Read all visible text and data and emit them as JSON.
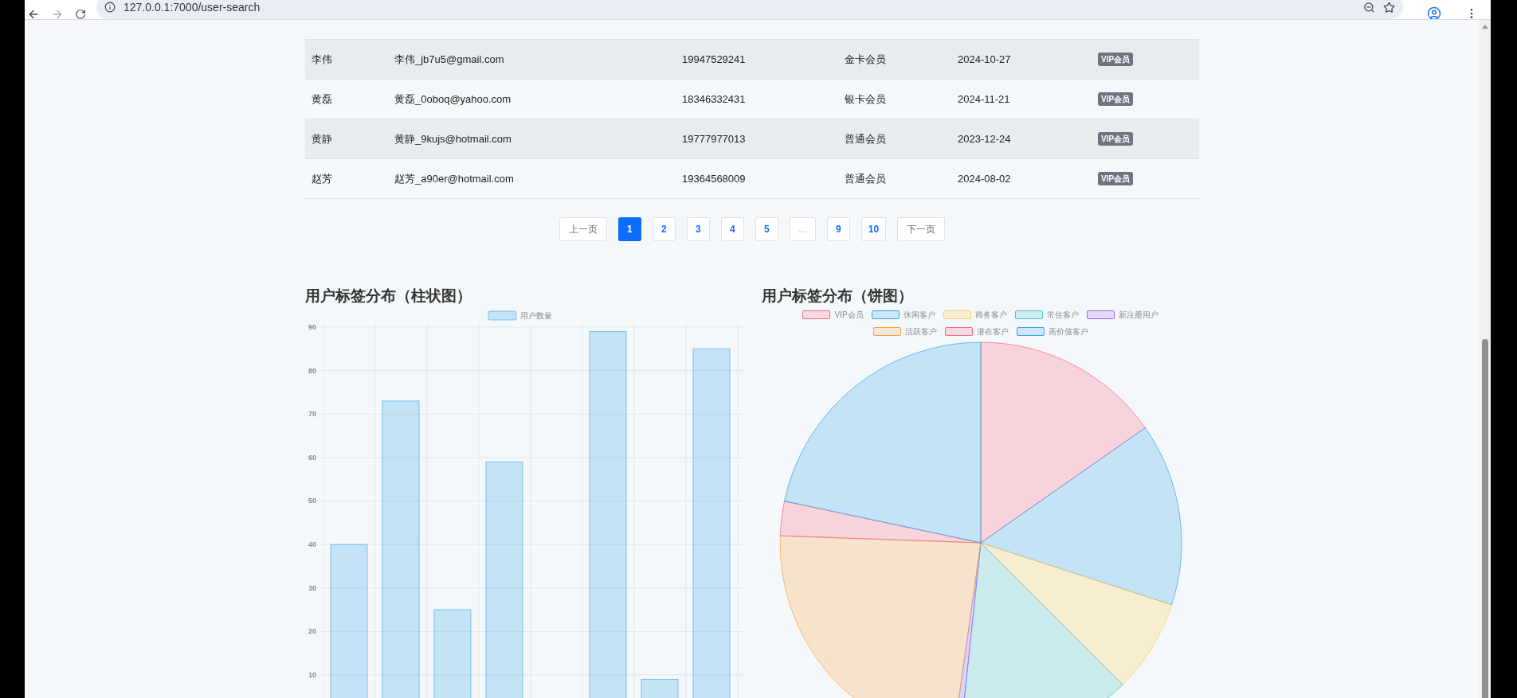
{
  "browser": {
    "url": "127.0.0.1:7000/user-search"
  },
  "table": {
    "rows": [
      {
        "name": "李伟",
        "email": "李伟_jb7u5@gmail.com",
        "phone": "19947529241",
        "level": "金卡会员",
        "date": "2024-10-27",
        "tag": "VIP会员"
      },
      {
        "name": "黄磊",
        "email": "黄磊_0oboq@yahoo.com",
        "phone": "18346332431",
        "level": "银卡会员",
        "date": "2024-11-21",
        "tag": "VIP会员"
      },
      {
        "name": "黄静",
        "email": "黄静_9kujs@hotmail.com",
        "phone": "19777977013",
        "level": "普通会员",
        "date": "2023-12-24",
        "tag": "VIP会员"
      },
      {
        "name": "赵芳",
        "email": "赵芳_a90er@hotmail.com",
        "phone": "19364568009",
        "level": "普通会员",
        "date": "2024-08-02",
        "tag": "VIP会员"
      }
    ]
  },
  "pagination": [
    {
      "label": "上一页",
      "kind": "nav",
      "selected": false
    },
    {
      "label": "1",
      "kind": "page",
      "selected": true
    },
    {
      "label": "2",
      "kind": "page",
      "selected": false
    },
    {
      "label": "3",
      "kind": "page",
      "selected": false
    },
    {
      "label": "4",
      "kind": "page",
      "selected": false
    },
    {
      "label": "5",
      "kind": "page",
      "selected": false
    },
    {
      "label": "...",
      "kind": "ellipsis",
      "selected": false
    },
    {
      "label": "9",
      "kind": "page",
      "selected": false
    },
    {
      "label": "10",
      "kind": "page",
      "selected": false
    },
    {
      "label": "下一页",
      "kind": "nav",
      "selected": false
    }
  ],
  "bar_chart": {
    "title": "用户标签分布（柱状图）",
    "chart_data": {
      "type": "bar",
      "grid": true,
      "ylim": [
        0,
        90
      ],
      "yticks": [
        10,
        20,
        30,
        40,
        50,
        60,
        70,
        80,
        90
      ],
      "series": [
        {
          "name": "用户数量",
          "color": "#36a2eb",
          "values": [
            40,
            73,
            25,
            59,
            0,
            89,
            9,
            85
          ]
        }
      ]
    }
  },
  "pie_chart": {
    "title": "用户标签分布（饼图）",
    "legend": [
      {
        "label": "VIP会员",
        "color": "#ff6384"
      },
      {
        "label": "休闲客户",
        "color": "#36a2eb"
      },
      {
        "label": "商务客户",
        "color": "#ffce56"
      },
      {
        "label": "常住客户",
        "color": "#4bc0c0"
      },
      {
        "label": "新注册用户",
        "color": "#9966ff"
      },
      {
        "label": "活跃客户",
        "color": "#ff9f40"
      },
      {
        "label": "潜在客户",
        "color": "#ff6384"
      },
      {
        "label": "高价值客户",
        "color": "#36a2eb"
      }
    ]
  }
}
